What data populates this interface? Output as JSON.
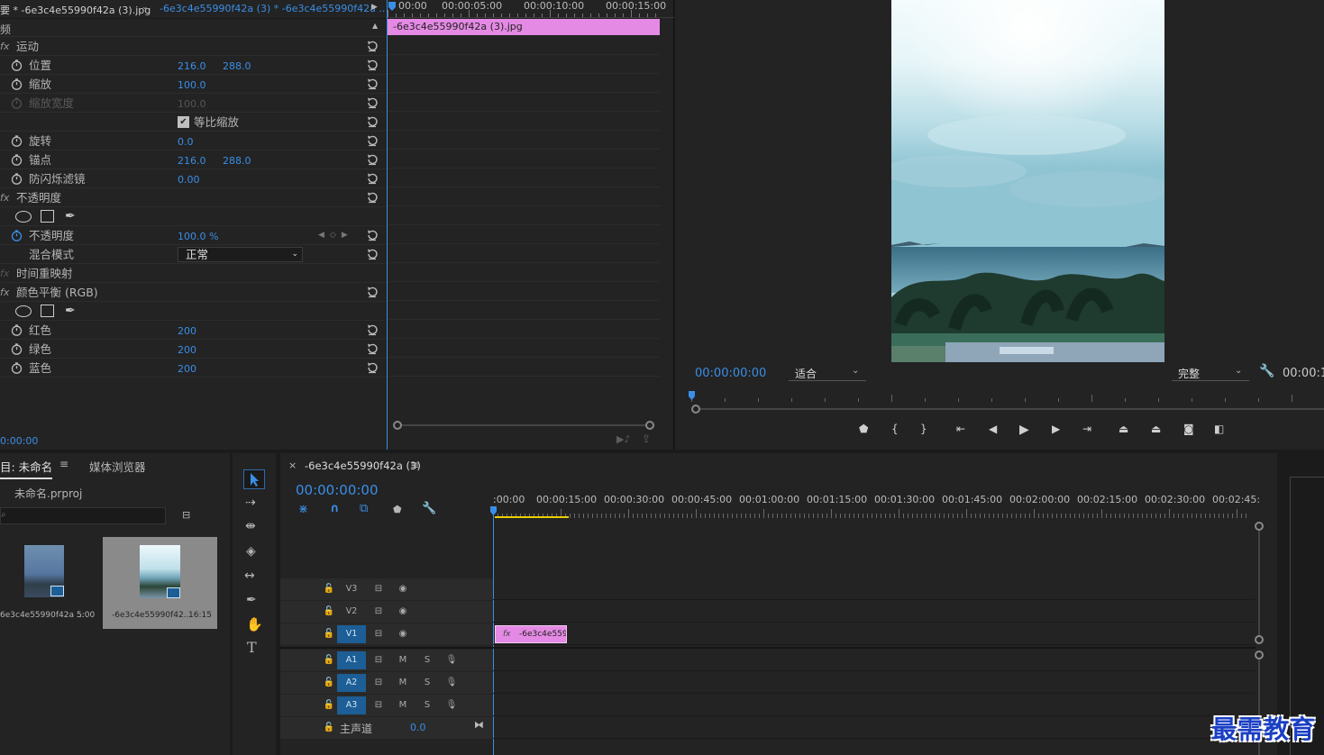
{
  "effect_controls": {
    "tab_source": "要 * -6e3c4e55990f42a (3).jpg",
    "tab_clip": "-6e3c4e55990f42a (3) * -6e3c4e55990f42a ...",
    "section_label": "频",
    "rows": [
      {
        "fx": "fx",
        "label": "运动",
        "stopwatch": false,
        "values": [],
        "reset": true,
        "indent": 18
      },
      {
        "fx": "",
        "label": "位置",
        "stopwatch": true,
        "values": [
          "216.0",
          "288.0"
        ],
        "reset": true,
        "indent": 32
      },
      {
        "fx": "",
        "label": "缩放",
        "stopwatch": true,
        "values": [
          "100.0"
        ],
        "reset": true,
        "indent": 32
      },
      {
        "fx": "",
        "label": "缩放宽度",
        "stopwatch": true,
        "values": [
          "100.0"
        ],
        "reset": true,
        "indent": 32,
        "disabled": true
      },
      {
        "fx": "",
        "label": "",
        "checkbox": "等比缩放",
        "stopwatch": false,
        "values": [],
        "reset": true,
        "indent": 32
      },
      {
        "fx": "",
        "label": "旋转",
        "stopwatch": true,
        "values": [
          "0.0"
        ],
        "reset": true,
        "indent": 32
      },
      {
        "fx": "",
        "label": "锚点",
        "stopwatch": true,
        "values": [
          "216.0",
          "288.0"
        ],
        "reset": true,
        "indent": 32
      },
      {
        "fx": "",
        "label": "防闪烁滤镜",
        "stopwatch": true,
        "values": [
          "0.00"
        ],
        "reset": true,
        "indent": 32
      },
      {
        "fx": "fx",
        "label": "不透明度",
        "stopwatch": false,
        "values": [],
        "reset": true,
        "indent": 18
      },
      {
        "fx": "",
        "label": "",
        "masks": true,
        "stopwatch": false,
        "values": [],
        "reset": false,
        "indent": 32
      },
      {
        "fx": "",
        "label": "不透明度",
        "stopwatch": true,
        "stopwatch_active": true,
        "values": [
          "100.0 %"
        ],
        "keyframe_nav": true,
        "reset": true,
        "indent": 32
      },
      {
        "fx": "",
        "label": "混合模式",
        "stopwatch": false,
        "dropdown": "正常",
        "values": [],
        "reset": true,
        "indent": 32
      },
      {
        "fx": "fx",
        "label": "时间重映射",
        "stopwatch": false,
        "values": [],
        "reset": false,
        "indent": 18,
        "fx_dim": true
      },
      {
        "fx": "fx",
        "label": "颜色平衡 (RGB)",
        "stopwatch": false,
        "values": [],
        "reset": true,
        "indent": 18
      },
      {
        "fx": "",
        "label": "",
        "masks": true,
        "stopwatch": false,
        "values": [],
        "reset": false,
        "indent": 32
      },
      {
        "fx": "",
        "label": "红色",
        "stopwatch": true,
        "values": [
          "200"
        ],
        "reset": true,
        "indent": 32
      },
      {
        "fx": "",
        "label": "绿色",
        "stopwatch": true,
        "values": [
          "200"
        ],
        "reset": true,
        "indent": 32
      },
      {
        "fx": "",
        "label": "蓝色",
        "stopwatch": true,
        "values": [
          "200"
        ],
        "reset": true,
        "indent": 32
      }
    ],
    "timecode": "0:00:00",
    "mini_ruler": [
      "00:00",
      "00:00:05:00",
      "00:00:10:00",
      "00:00:15:00"
    ],
    "clip_label": "-6e3c4e55990f42a (3).jpg"
  },
  "program_monitor": {
    "timecode": "00:00:00:00",
    "fit_select": "适合",
    "quality_select": "完整",
    "duration_timecode": "00:00:1",
    "transport_icons": [
      "marker-icon",
      "mark-in-icon",
      "mark-out-icon",
      "go-to-in-icon",
      "step-back-icon",
      "play-icon",
      "step-forward-icon",
      "go-to-out-icon",
      "lift-icon",
      "extract-icon",
      "export-frame-icon",
      "compare-icon"
    ]
  },
  "project": {
    "tab_project": "目: 未命名",
    "tab_media": "媒体浏览器",
    "project_file": "未命名.prproj",
    "items": [
      {
        "name": "6e3c4e55990f42a ...",
        "duration": "5:00",
        "selected": false
      },
      {
        "name": "-6e3c4e55990f42...",
        "duration": "16:15",
        "selected": true
      }
    ]
  },
  "timeline": {
    "sequence_name": "-6e3c4e55990f42a (3)",
    "timecode": "00:00:00:00",
    "ruler": [
      ":00:00",
      "00:00:15:00",
      "00:00:30:00",
      "00:00:45:00",
      "00:01:00:00",
      "00:01:15:00",
      "00:01:30:00",
      "00:01:45:00",
      "00:02:00:00",
      "00:02:15:00",
      "00:02:30:00",
      "00:02:45:"
    ],
    "video_tracks": [
      {
        "name": "V3",
        "active": false
      },
      {
        "name": "V2",
        "active": false
      },
      {
        "name": "V1",
        "active": true
      }
    ],
    "audio_tracks": [
      {
        "name": "A1"
      },
      {
        "name": "A2"
      },
      {
        "name": "A3"
      }
    ],
    "mute_label": "M",
    "solo_label": "S",
    "master_label": "主声道",
    "master_value": "0.0",
    "clip_label": "-6e3c4e559",
    "clip_fx": "fx"
  },
  "watermark": "最需教育",
  "colors": {
    "accent": "#3a8ee6",
    "clip_pink": "#e48ae4",
    "track_blue": "#1c5e95",
    "work_area": "#e8d000"
  }
}
